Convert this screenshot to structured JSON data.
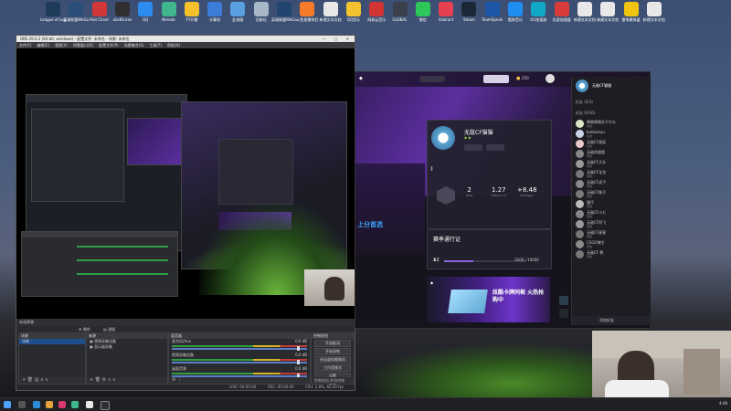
{
  "desktop_icons": [
    {
      "label": "League of Legends",
      "color": "#1f3b5a"
    },
    {
      "label": "英雄联盟WeGame版",
      "color": "#2a4f7a"
    },
    {
      "label": "Riot Client",
      "color": "#d13639"
    },
    {
      "label": "obs64.exe",
      "color": "#302e31"
    },
    {
      "label": "QQ",
      "color": "#2d8cf0"
    },
    {
      "label": "Nimate",
      "color": "#3fb68b"
    },
    {
      "label": "YY开播",
      "color": "#f5c02c"
    },
    {
      "label": "计算机",
      "color": "#3b7dd8"
    },
    {
      "label": "此电脑",
      "color": "#5aa0e0"
    },
    {
      "label": "回收站",
      "color": "#a9b8c8"
    },
    {
      "label": "英雄联盟WeGame",
      "color": "#20456f"
    },
    {
      "label": "斗鱼直播伴侣",
      "color": "#f77b2a"
    },
    {
      "label": "新建文本文档",
      "color": "#e8e8e8"
    },
    {
      "label": "QQ音乐",
      "color": "#f2c230"
    },
    {
      "label": "网易云音乐",
      "color": "#d23434"
    },
    {
      "label": "GLOBAL",
      "color": "#3a3f4b"
    },
    {
      "label": "微信",
      "color": "#2ec75a"
    },
    {
      "label": "Valorant",
      "color": "#e5404f"
    },
    {
      "label": "Steam",
      "color": "#1b2838"
    },
    {
      "label": "TeamSpeak",
      "color": "#1d58a8"
    },
    {
      "label": "酷狗音乐",
      "color": "#1f8ef1"
    },
    {
      "label": "UU加速器",
      "color": "#11a8c8"
    },
    {
      "label": "迅游加速器",
      "color": "#d93b3b"
    },
    {
      "label": "新建文本文档",
      "color": "#e8e8e8"
    },
    {
      "label": "新建文本文档",
      "color": "#e8e8e8"
    },
    {
      "label": "雷电模拟器",
      "color": "#f1c40f"
    },
    {
      "label": "新建文本文档",
      "color": "#e8e8e8"
    }
  ],
  "obs": {
    "title": "OBS 29.0.2 (64-bit, windows) - 配置文件: 未命名 - 场景: 未命名",
    "menu": [
      "文件(F)",
      "编辑(E)",
      "视图(V)",
      "停靠窗口(D)",
      "配置文件(P)",
      "场景集合(S)",
      "工具(T)",
      "帮助(H)"
    ],
    "status_left": "未选择源",
    "toolbar": {
      "props": "属性",
      "filters": "滤镜"
    },
    "docks": {
      "scenes": {
        "title": "场景",
        "items": [
          "场景"
        ]
      },
      "sources": {
        "title": "来源",
        "items": [
          "视频采集设备",
          "显示器采集"
        ]
      },
      "mixer": {
        "title": "混音器",
        "channels": [
          {
            "name": "麦克风/Aux",
            "db": "0.0 dB"
          },
          {
            "name": "视频采集设备",
            "db": "0.0 dB"
          },
          {
            "name": "桌面音频",
            "db": "0.0 dB"
          }
        ]
      },
      "controls": {
        "title": "控制按钮",
        "buttons": [
          "开始推流",
          "开始录制",
          "启动虚拟摄像机",
          "工作室模式",
          "设置",
          "退出"
        ]
      },
      "foot_tabs": [
        "控制按钮",
        "转场特效"
      ]
    },
    "bottom": {
      "live": "LIVE: 00:00:00",
      "rec": "REC: 00:00:00",
      "cpu": "CPU: 2.8%, 60.00 fps"
    }
  },
  "game": {
    "player_name": "无敌CF猫猫",
    "stats": [
      {
        "value": "2",
        "label": "Wins"
      },
      {
        "value": "1.27",
        "label": "Rating 2.0"
      },
      {
        "value": "+8.48",
        "label": "Damage+"
      }
    ],
    "season_label": "赛季通行证",
    "pass_level": "2",
    "pass_progress": "3500 / 10000",
    "pass_fraction": 0.35,
    "banner_text": "炫酷卡牌同框 火热抢购中",
    "hero_text": "上分首选",
    "coins": "250"
  },
  "friends": {
    "title": "无敌CF猫猫",
    "groups": [
      "好友 (0/3)",
      "好友 (0/36)"
    ],
    "list": [
      {
        "name": "嘀嗒嘀嗒在干什么",
        "status": "在线"
      },
      {
        "name": "bukbukuu",
        "status": "在线"
      },
      {
        "name": "无敌CF星辰",
        "status": "在线"
      },
      {
        "name": "无敌的超超",
        "status": "离线"
      },
      {
        "name": "无敌CF大头",
        "status": "离线"
      },
      {
        "name": "无敌CF龙龙",
        "status": "离线"
      },
      {
        "name": "无敌CF虎子",
        "status": "离线"
      },
      {
        "name": "无敌CF猴子",
        "status": "离线"
      },
      {
        "name": "猫仔",
        "status": "离线"
      },
      {
        "name": "无敌CF小七",
        "status": "离线"
      },
      {
        "name": "无敌CF阿飞",
        "status": "离线"
      },
      {
        "name": "无敌CF星星",
        "status": "离线"
      },
      {
        "name": "CSGO博主",
        "status": "离线"
      },
      {
        "name": "无敌CF 熊",
        "status": "离线"
      }
    ],
    "add_friend": "添加好友"
  },
  "taskbar": {
    "time": "4:48"
  }
}
